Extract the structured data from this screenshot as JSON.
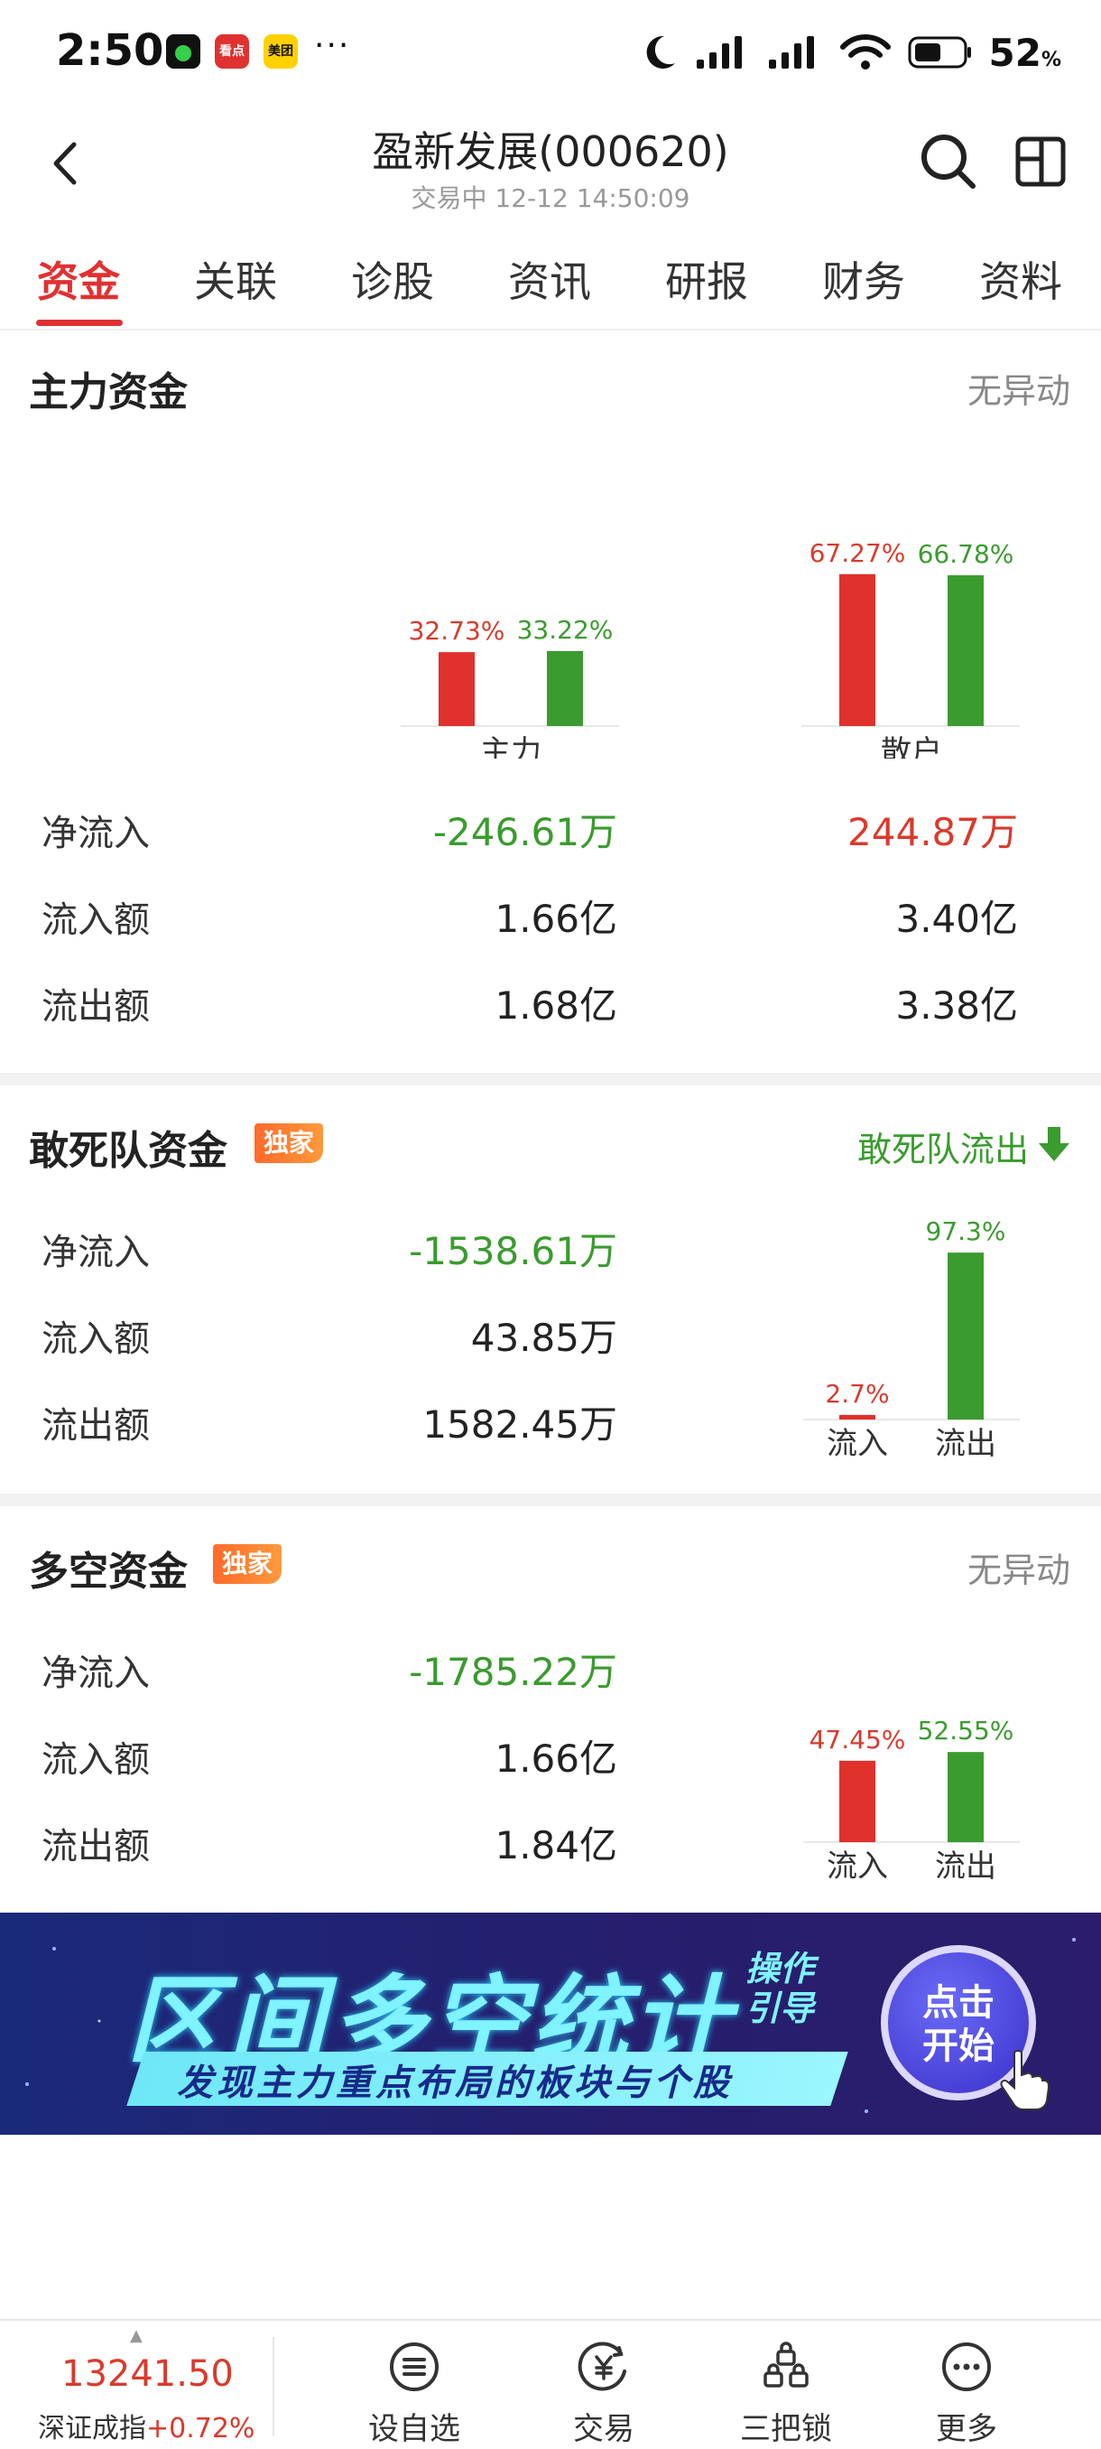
{
  "status_bar": {
    "time": "2:50",
    "apps": [
      {
        "name": "app-icon-green",
        "label": "",
        "color": "#111111"
      },
      {
        "name": "app-icon-kandian",
        "label": "看点",
        "color": "#e03131"
      },
      {
        "name": "app-icon-meituan",
        "label": "美团",
        "color": "#ffd100"
      }
    ],
    "more": "···",
    "battery_percent": "52",
    "battery_unit": "%"
  },
  "header": {
    "title": "盈新发展(000620)",
    "subtitle": "交易中 12-12 14:50:09"
  },
  "tabs": [
    "资金",
    "关联",
    "诊股",
    "资讯",
    "研报",
    "财务",
    "资料"
  ],
  "main_funds": {
    "title": "主力资金",
    "status": "无异动",
    "groups": [
      {
        "label": "主力",
        "in_pct": "32.73%",
        "out_pct": "33.22%",
        "in": 32.73,
        "out": 33.22
      },
      {
        "label": "散户",
        "in_pct": "67.27%",
        "out_pct": "66.78%",
        "in": 67.27,
        "out": 66.78
      }
    ],
    "rows": [
      {
        "label": "净流入",
        "main": "-246.61万",
        "retail": "244.87万"
      },
      {
        "label": "流入额",
        "main": "1.66亿",
        "retail": "3.40亿"
      },
      {
        "label": "流出额",
        "main": "1.68亿",
        "retail": "3.38亿"
      }
    ]
  },
  "dare_funds": {
    "title": "敢死队资金",
    "badge": "独家",
    "status": "敢死队流出",
    "rows": [
      {
        "label": "净流入",
        "value": "-1538.61万"
      },
      {
        "label": "流入额",
        "value": "43.85万"
      },
      {
        "label": "流出额",
        "value": "1582.45万"
      }
    ],
    "chart": {
      "in_pct": "2.7%",
      "out_pct": "97.3%",
      "in": 2.7,
      "out": 97.3,
      "in_label": "流入",
      "out_label": "流出"
    }
  },
  "longshort_funds": {
    "title": "多空资金",
    "badge": "独家",
    "status": "无异动",
    "rows": [
      {
        "label": "净流入",
        "value": "-1785.22万"
      },
      {
        "label": "流入额",
        "value": "1.66亿"
      },
      {
        "label": "流出额",
        "value": "1.84亿"
      }
    ],
    "chart": {
      "in_pct": "47.45%",
      "out_pct": "52.55%",
      "in": 47.45,
      "out": 52.55,
      "in_label": "流入",
      "out_label": "流出"
    }
  },
  "banner": {
    "title": "区间多空统计",
    "tag_line1": "操作",
    "tag_line2": "引导",
    "subtitle": "发现主力重点布局的板块与个股",
    "button_line1": "点击",
    "button_line2": "开始"
  },
  "bottom_bar": {
    "index_value": "13241.50",
    "index_name": "深证成指",
    "index_change": "+0.72%",
    "items": [
      {
        "label": "设自选",
        "icon": "list-circle-icon"
      },
      {
        "label": "交易",
        "icon": "yuan-circle-icon"
      },
      {
        "label": "三把锁",
        "icon": "locks-icon"
      },
      {
        "label": "更多",
        "icon": "more-dots-icon"
      }
    ]
  },
  "colors": {
    "up": "#d93a2c",
    "down": "#3a9b2e",
    "accent": "#e03131"
  }
}
